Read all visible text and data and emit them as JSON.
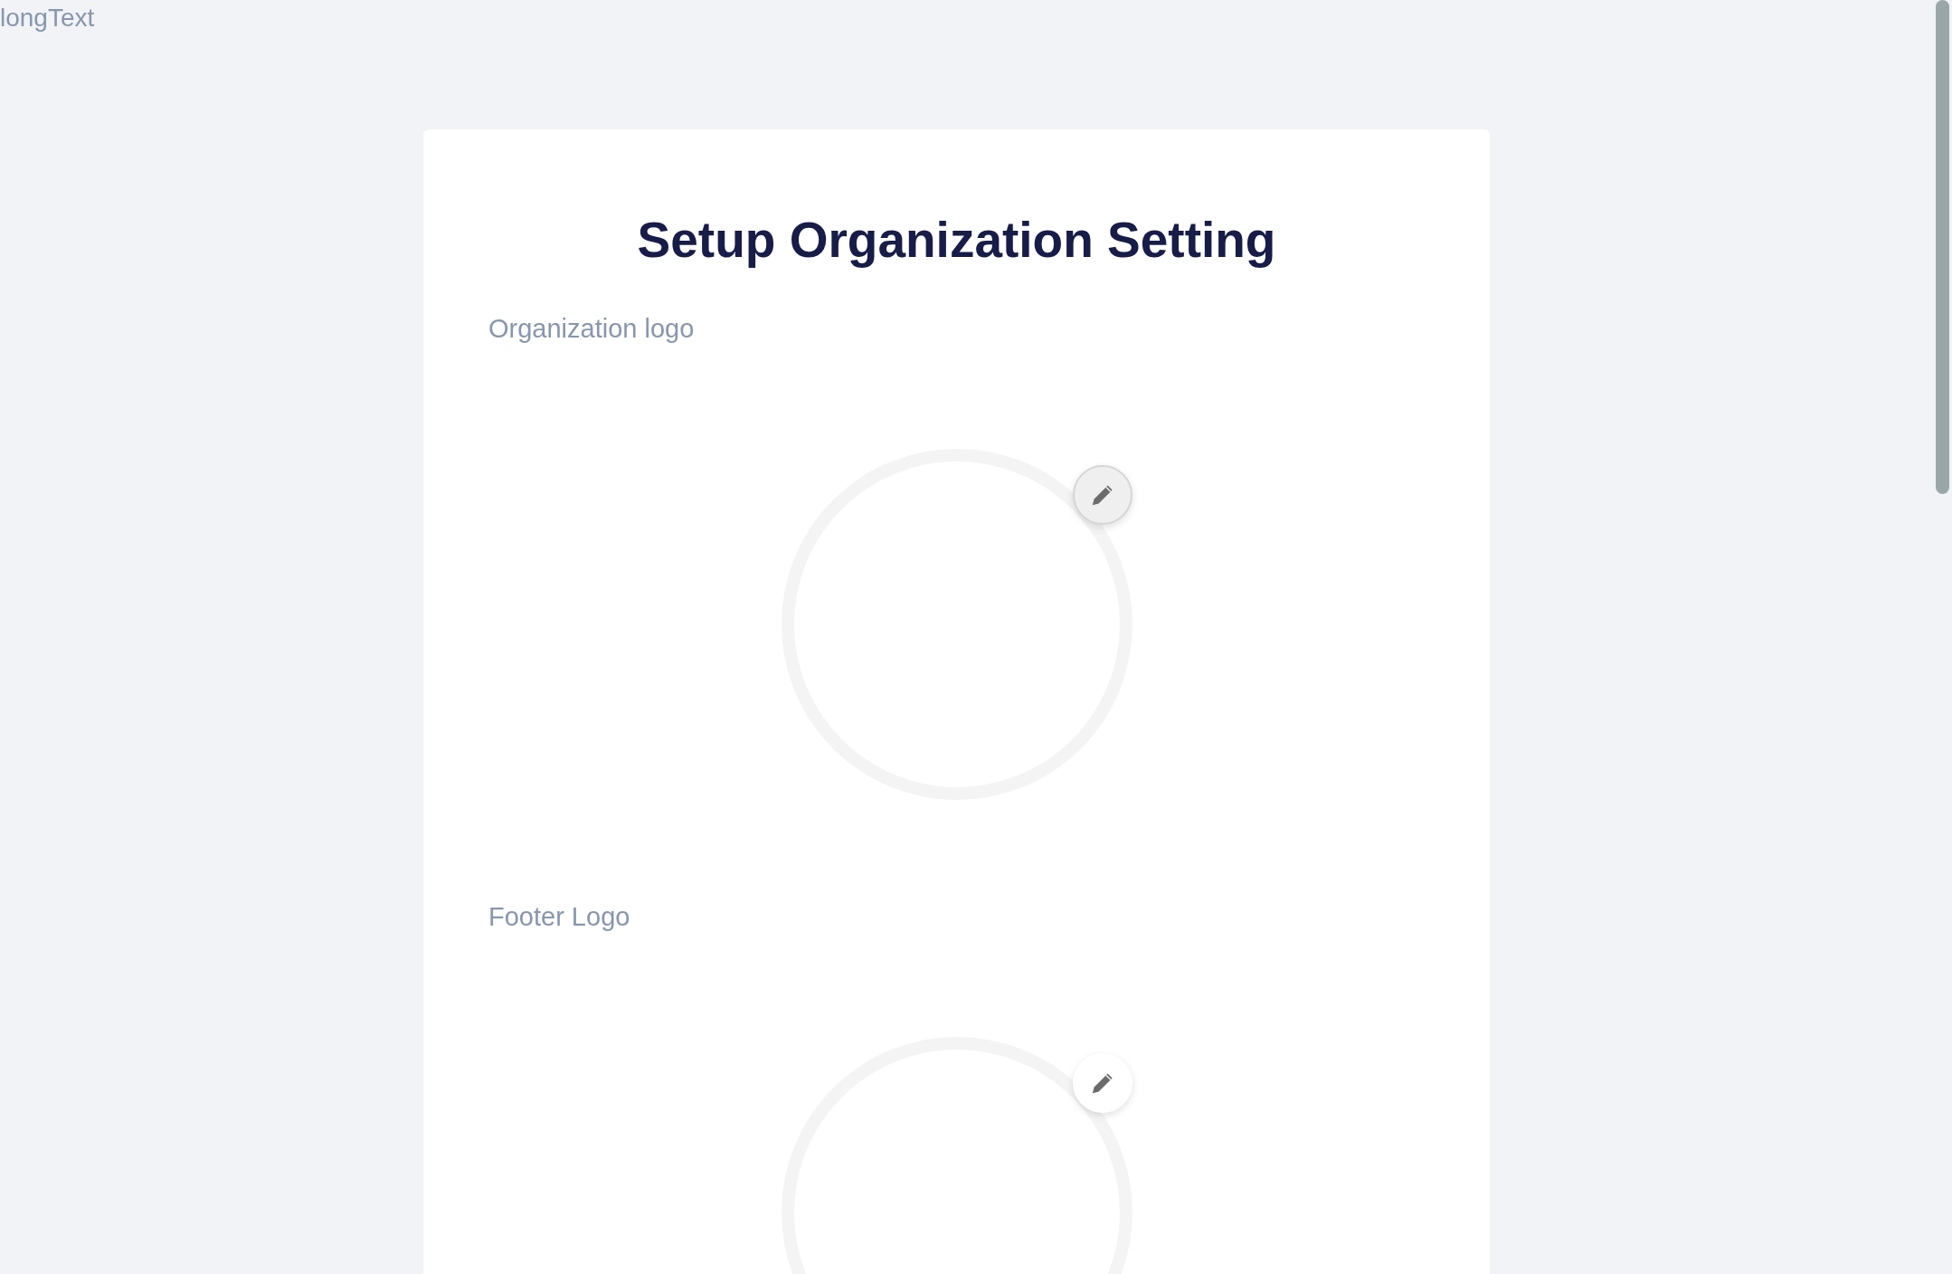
{
  "corner_text": "longText",
  "title": "Setup Organization Setting",
  "logo_sections": [
    {
      "label": "Organization logo",
      "edit_highlighted": true
    },
    {
      "label": "Footer Logo",
      "edit_highlighted": false
    }
  ]
}
